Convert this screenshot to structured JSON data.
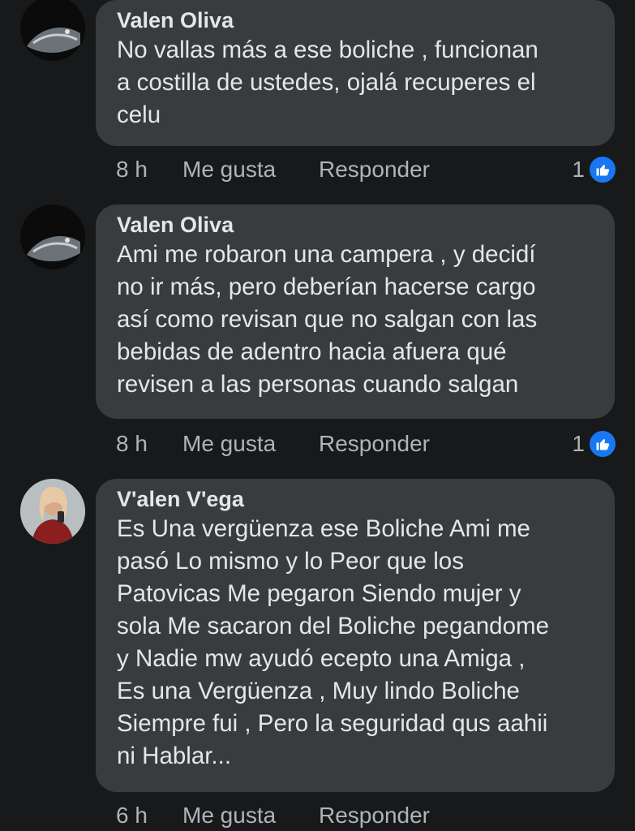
{
  "comments": [
    {
      "author": "Valen Oliva",
      "lines": [
        "No vallas más a ese boliche , funcionan",
        "a costilla de ustedes, ojalá recuperes el",
        "celu"
      ],
      "time": "8 h",
      "like_label": "Me gusta",
      "reply_label": "Responder",
      "reaction_count": "1",
      "reaction_icon": "like-icon"
    },
    {
      "author": "Valen Oliva",
      "lines": [
        "Ami me robaron una campera , y decidí",
        "no ir más, pero deberían hacerse cargo",
        "así como revisan que no salgan con las",
        "bebidas de adentro hacia afuera qué",
        "revisen a las personas cuando salgan"
      ],
      "time": "8 h",
      "like_label": "Me gusta",
      "reply_label": "Responder",
      "reaction_count": "1",
      "reaction_icon": "like-icon"
    },
    {
      "author": "V'alen V'ega",
      "lines": [
        "Es Una vergüenza ese Boliche Ami me",
        "pasó Lo mismo y lo Peor que los",
        "Patovicas Me pegaron Siendo mujer y",
        "sola Me sacaron del Boliche pegandome",
        "y Nadie mw ayudó ecepto una Amiga ,",
        "Es una Vergüenza , Muy lindo Boliche",
        "Siempre fui , Pero la seguridad qus aahii",
        "ni Hablar..."
      ],
      "time": "6 h",
      "like_label": "Me gusta",
      "reply_label": "Responder"
    }
  ],
  "colors": {
    "background": "#18191a",
    "bubble": "#3a3b3c",
    "text": "#e4e6eb",
    "secondary": "#b0b3b8",
    "like_blue": "#1877f2"
  }
}
